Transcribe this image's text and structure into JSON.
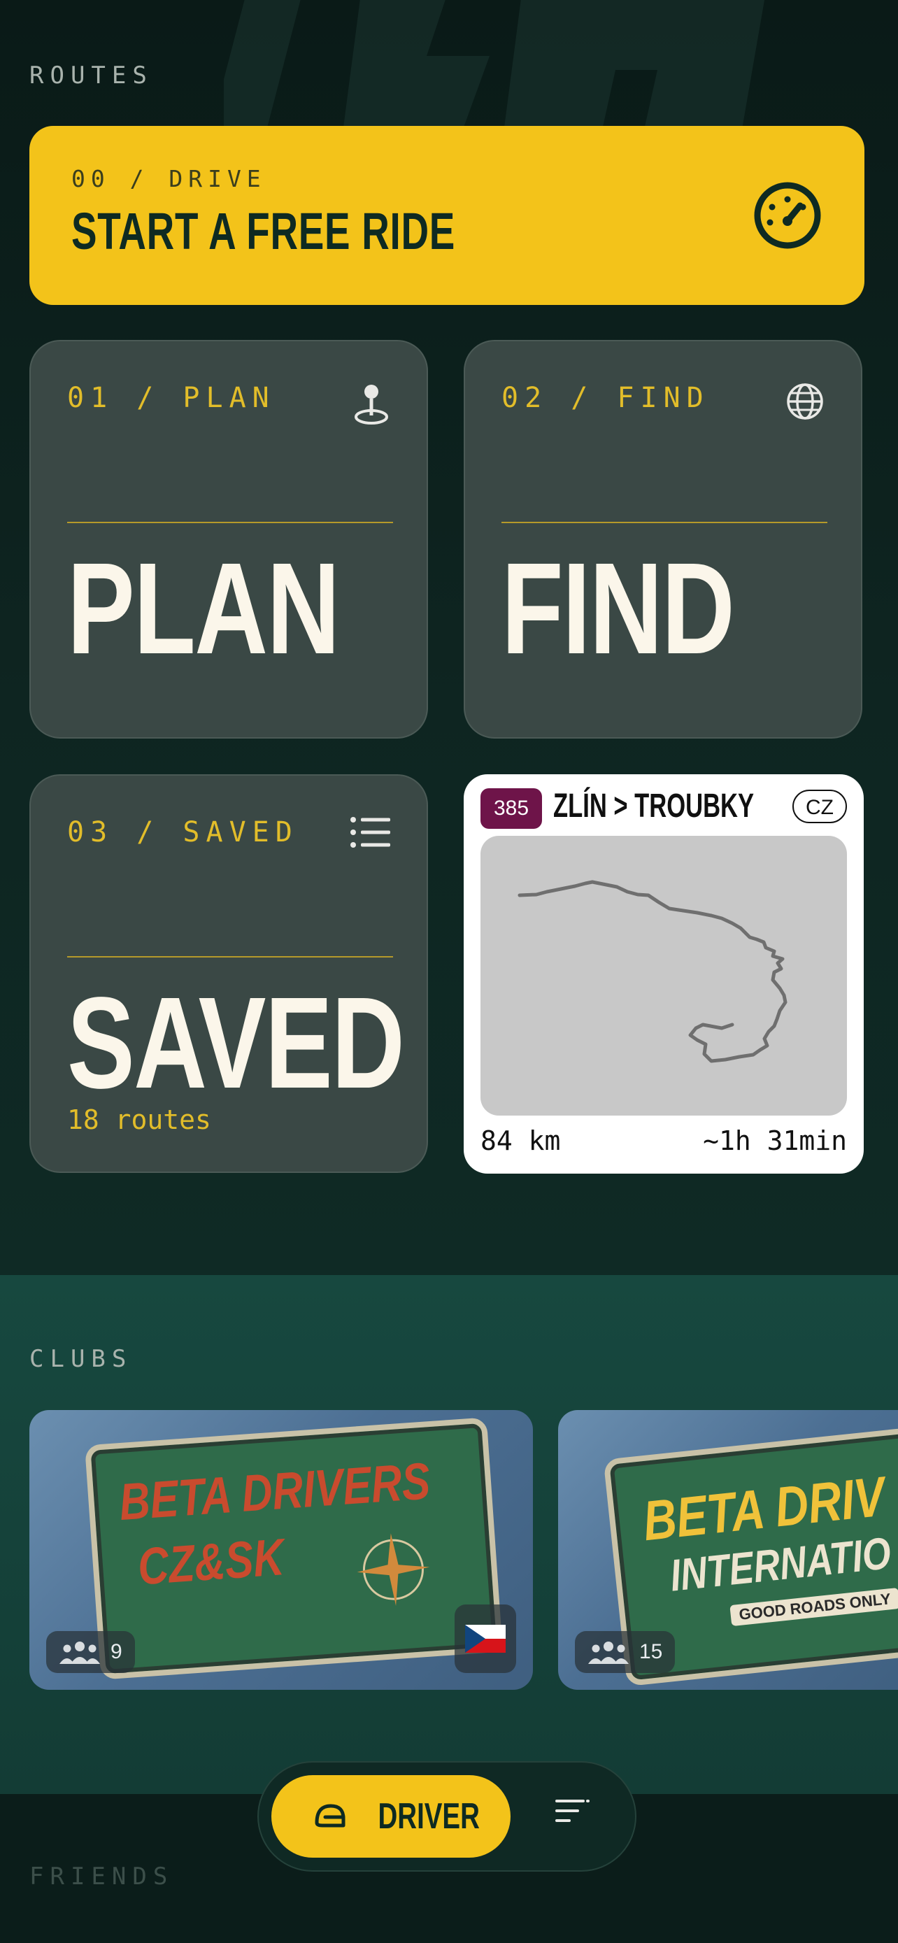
{
  "routes": {
    "section_label": "ROUTES",
    "start_card": {
      "kicker": "00 / DRIVE",
      "title": "START A FREE RIDE",
      "icon": "speedometer-icon"
    },
    "tiles": [
      {
        "kicker": "01 / PLAN",
        "title": "PLAN",
        "icon": "map-pin-icon"
      },
      {
        "kicker": "02 / FIND",
        "title": "FIND",
        "icon": "globe-icon"
      },
      {
        "kicker": "03 / SAVED",
        "title": "SAVED",
        "icon": "list-icon",
        "count": "18 routes"
      }
    ],
    "route_card": {
      "number": "385",
      "name": "ZLÍN > TROUBKY",
      "country": "CZ",
      "distance": "84 km",
      "duration": "~1h 31min"
    }
  },
  "clubs": {
    "section_label": "CLUBS",
    "items": [
      {
        "patch_line1": "BETA DRIVERS",
        "patch_line2": "CZ&SK",
        "members": "9",
        "flag": "czech-flag-icon"
      },
      {
        "patch_line1": "BETA DRIV",
        "patch_line2": "INTERNATIO",
        "patch_line3": "GOOD ROADS ONLY",
        "members": "15"
      }
    ]
  },
  "friends": {
    "section_label": "FRIENDS"
  },
  "bottom_bar": {
    "driver_label": "DRIVER",
    "driver_icon": "helmet-icon",
    "menu_icon": "menu-icon"
  },
  "colors": {
    "accent": "#f3c31a",
    "tile": "#3a4845",
    "route_badge": "#6e1449",
    "kicker": "#e2bd2a"
  }
}
